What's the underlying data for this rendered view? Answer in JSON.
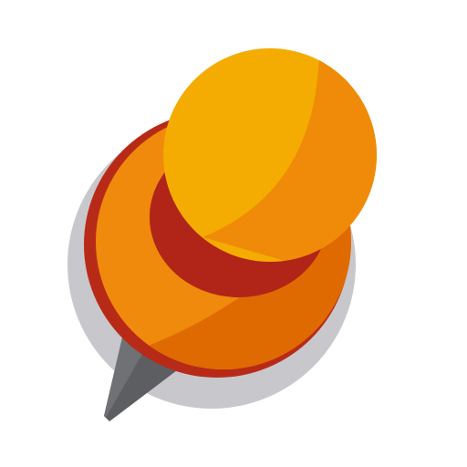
{
  "icon": {
    "name": "pushpin-icon",
    "colors": {
      "background": "#ffffff",
      "shadow": "#c8c8cc",
      "needle": "#5d5e62",
      "needle_highlight": "#707175",
      "base_rim": "#b82a18",
      "base_orange": "#ef8a0c",
      "base_orange_dark": "#e06a02",
      "neck_red": "#b02517",
      "head_yellow": "#f4ac02",
      "head_orange": "#ef8b08"
    }
  }
}
